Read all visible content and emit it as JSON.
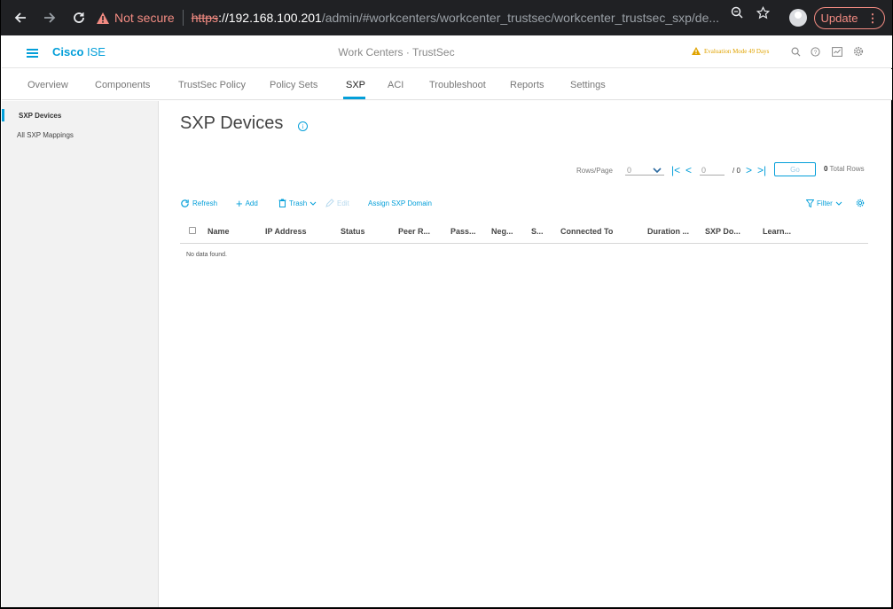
{
  "browser": {
    "back_icon": "arrow-left",
    "forward_icon": "arrow-right",
    "reload_icon": "reload",
    "security_label": "Not secure",
    "url_scheme": "https",
    "url_host": "://192.168.100.201",
    "url_path": "/admin/#workcenters/workcenter_trustsec/workcenter_trustsec_sxp/de...",
    "update_label": "Update",
    "accent_color": "#f28b82"
  },
  "header": {
    "brand_bold": "Cisco",
    "brand_rest": " ISE",
    "title": "Work Centers · TrustSec",
    "evaluation": "Evaluation Mode 49 Days"
  },
  "tabs": [
    {
      "label": "Overview",
      "active": false
    },
    {
      "label": "Components",
      "active": false
    },
    {
      "label": "TrustSec Policy",
      "active": false
    },
    {
      "label": "Policy Sets",
      "active": false
    },
    {
      "label": "SXP",
      "active": true
    },
    {
      "label": "ACI",
      "active": false
    },
    {
      "label": "Troubleshoot",
      "active": false
    },
    {
      "label": "Reports",
      "active": false
    },
    {
      "label": "Settings",
      "active": false
    }
  ],
  "sidebar": {
    "items": [
      {
        "label": "SXP Devices",
        "active": true
      },
      {
        "label": "All SXP Mappings",
        "active": false
      }
    ]
  },
  "main": {
    "title": "SXP Devices",
    "pagination": {
      "rows_per_page_label": "Rows/Page",
      "rows_per_page_value": "0",
      "page_value": "0",
      "page_total": "/ 0",
      "go_label": "Go",
      "total_count": "0",
      "total_label": "Total Rows"
    },
    "toolbar": {
      "refresh": "Refresh",
      "add": "Add",
      "trash": "Trash",
      "edit": "Edit",
      "assign": "Assign SXP Domain",
      "filter": "Filter"
    },
    "table": {
      "columns": [
        "Name",
        "IP Address",
        "Status",
        "Peer R...",
        "Pass...",
        "Neg...",
        "S...",
        "Connected To",
        "Duration ...",
        "SXP Do...",
        "Learn..."
      ],
      "empty_text": "No data found."
    }
  },
  "colors": {
    "primary": "#049fd9",
    "warning": "#e0a300"
  }
}
